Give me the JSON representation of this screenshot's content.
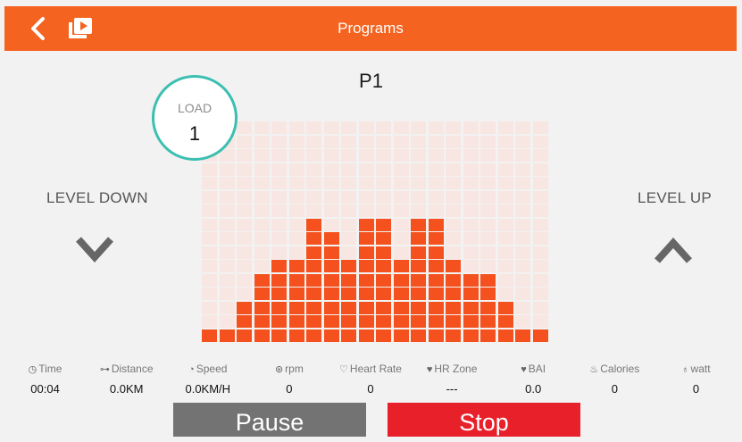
{
  "header": {
    "title": "Programs",
    "back_icon": "chevron-left-icon",
    "video_icon": "video-list-icon"
  },
  "program": {
    "name": "P1"
  },
  "load": {
    "label": "LOAD",
    "value": "1"
  },
  "level_down": {
    "label": "LEVEL DOWN",
    "icon": "chevron-down-icon"
  },
  "level_up": {
    "label": "LEVEL UP",
    "icon": "chevron-up-icon"
  },
  "profile": {
    "rows": 16,
    "columns": 20,
    "levels": [
      1,
      1,
      3,
      5,
      6,
      6,
      9,
      8,
      6,
      9,
      9,
      6,
      9,
      9,
      6,
      5,
      5,
      3,
      1,
      1
    ],
    "active_color": "#f4511e",
    "inactive_color": "#f7e6e1"
  },
  "stats": [
    {
      "label": "Time",
      "icon": "clock-icon",
      "value": "00:04"
    },
    {
      "label": "Distance",
      "icon": "distance-icon",
      "value": "0.0KM"
    },
    {
      "label": "Speed",
      "icon": "speedometer-icon",
      "value": "0.0KM/H"
    },
    {
      "label": "rpm",
      "icon": "rpm-icon",
      "value": "0"
    },
    {
      "label": "Heart Rate",
      "icon": "heart-outline-icon",
      "value": "0"
    },
    {
      "label": "HR Zone",
      "icon": "heart-zone-icon",
      "value": "---"
    },
    {
      "label": "BAI",
      "icon": "heart-bai-icon",
      "value": "0.0"
    },
    {
      "label": "Calories",
      "icon": "flame-icon",
      "value": "0"
    },
    {
      "label": "watt",
      "icon": "bulb-icon",
      "value": "0"
    }
  ],
  "buttons": {
    "pause": "Pause",
    "stop": "Stop"
  }
}
